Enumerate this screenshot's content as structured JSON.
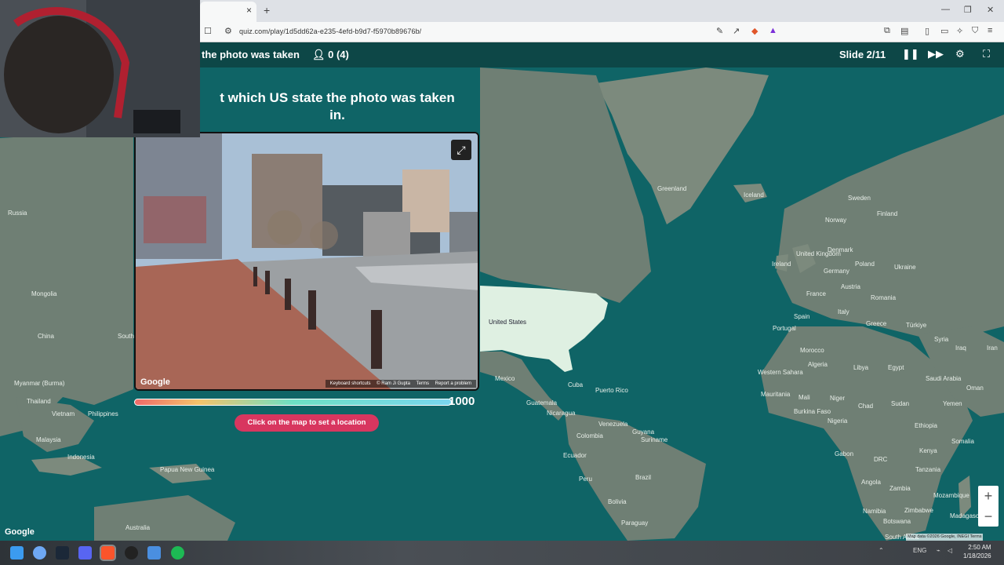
{
  "browser": {
    "url": "quiz.com/play/1d5dd62a-e235-4efd-b9d7-f5970b89676b/",
    "tab_close": "×",
    "new_tab": "+"
  },
  "quizbar": {
    "title": "the photo was taken",
    "players": "0 (4)",
    "slide": "Slide 2/11"
  },
  "question": {
    "line1": "t which US state the photo was taken",
    "line2": "in."
  },
  "streetview": {
    "google_logo": "Google",
    "footer": [
      "Keyboard shortcuts",
      "© Ram Ji Gupta",
      "Terms",
      "Report a problem"
    ]
  },
  "score": "1000",
  "timer_fraction": 0.95,
  "cta": "Click on the map to set a location",
  "map": {
    "labels": {
      "greenland": "Greenland",
      "iceland": "Iceland",
      "sweden": "Sweden",
      "finland": "Finland",
      "norway": "Norway",
      "uk": "United Kingdom",
      "ireland": "Ireland",
      "denmark": "Denmark",
      "poland": "Poland",
      "germany": "Germany",
      "ukraine": "Ukraine",
      "france": "France",
      "austria": "Austria",
      "romania": "Romania",
      "spain": "Spain",
      "italy": "Italy",
      "portugal": "Portugal",
      "greece": "Greece",
      "turkiye": "Türkiye",
      "syria": "Syria",
      "iraq": "Iraq",
      "iran": "Iran",
      "morocco": "Morocco",
      "algeria": "Algeria",
      "libya": "Libya",
      "egypt": "Egypt",
      "saudi": "Saudi Arabia",
      "oman": "Oman",
      "yemen": "Yemen",
      "western_sahara": "Western Sahara",
      "mauritania": "Mauritania",
      "mali": "Mali",
      "niger": "Niger",
      "chad": "Chad",
      "sudan": "Sudan",
      "burkina": "Burkina Faso",
      "nigeria": "Nigeria",
      "ethiopia": "Ethiopia",
      "gabon": "Gabon",
      "drc": "DRC",
      "kenya": "Kenya",
      "somalia": "Somalia",
      "tanzania": "Tanzania",
      "angola": "Angola",
      "zambia": "Zambia",
      "mozambique": "Mozambique",
      "namibia": "Namibia",
      "zimbabwe": "Zimbabwe",
      "botswana": "Botswana",
      "madagascar": "Madagascar",
      "south_africa": "South Africa",
      "russia": "Russia",
      "mongolia": "Mongolia",
      "china": "China",
      "south_korea": "South Korea",
      "myanmar": "Myanmar (Burma)",
      "thailand": "Thailand",
      "vietnam": "Vietnam",
      "philippines": "Philippines",
      "malaysia": "Malaysia",
      "indonesia": "Indonesia",
      "png": "Papua New Guinea",
      "australia": "Australia",
      "usa": "United States",
      "mexico": "Mexico",
      "cuba": "Cuba",
      "puerto_rico": "Puerto Rico",
      "guatemala": "Guatemala",
      "nicaragua": "Nicaragua",
      "venezuela": "Venezuela",
      "colombia": "Colombia",
      "guyana": "Guyana",
      "suriname": "Suriname",
      "ecuador": "Ecuador",
      "peru": "Peru",
      "brazil": "Brazil",
      "bolivia": "Bolivia",
      "paraguay": "Paraguay"
    },
    "google_logo": "Google",
    "attribution": "Map data ©2026 Google, INEGI  Terms",
    "zoom_in": "+",
    "zoom_out": "−"
  },
  "taskbar": {
    "lang": "ENG",
    "time": "2:50 AM",
    "date": "1/18/2026"
  }
}
